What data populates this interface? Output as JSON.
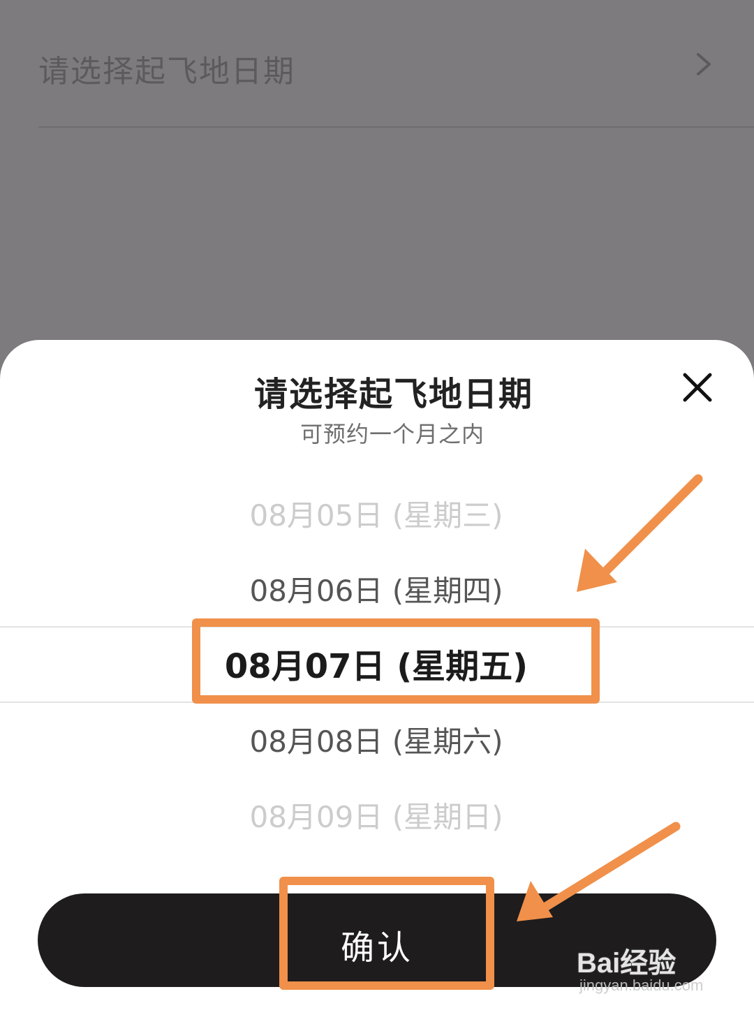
{
  "background": {
    "row_label": "请选择起飞地日期"
  },
  "sheet": {
    "title": "请选择起飞地日期",
    "subtitle": "可预约一个月之内"
  },
  "picker": {
    "items": [
      "08月05日 (星期三)",
      "08月06日 (星期四)",
      "08月07日 (星期五)",
      "08月08日 (星期六)",
      "08月09日 (星期日)"
    ],
    "selected_index": 2
  },
  "confirm_button": {
    "label": "确认"
  },
  "watermark": {
    "main": "Bai经验",
    "sub": "jingyan.baidu.com"
  },
  "colors": {
    "annotation": "#f0904a",
    "overlay": "#7d7b7e",
    "button": "#1e1c1d"
  }
}
